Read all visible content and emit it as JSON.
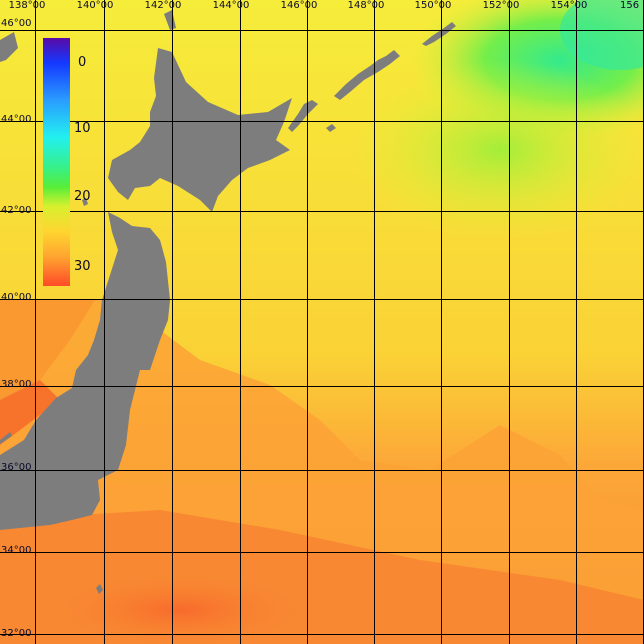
{
  "map": {
    "longitude_labels": [
      "138°00",
      "140°00",
      "142°00",
      "144°00",
      "146°00",
      "148°00",
      "150°00",
      "152°00",
      "154°00",
      "156"
    ],
    "latitude_labels": [
      "46°00",
      "44°00",
      "42°00",
      "40°00",
      "38°00",
      "36°00",
      "34°00",
      "32°00"
    ],
    "land_color": "#7d7d7d",
    "grid_color": "#000000"
  },
  "colorbar": {
    "tick_labels": [
      "0",
      "10",
      "20",
      "30"
    ],
    "colors": [
      "#5a0aa6",
      "#1438ff",
      "#2a9cff",
      "#22f0f0",
      "#36f08a",
      "#56ee3a",
      "#d8f02e",
      "#ffd530",
      "#ffa630",
      "#ff4a28"
    ]
  },
  "sea_colors": {
    "cold": "#40f070",
    "cool": "#b6ee3a",
    "mild": "#f4f030",
    "warm": "#fcb838",
    "hot": "#f87a30"
  }
}
